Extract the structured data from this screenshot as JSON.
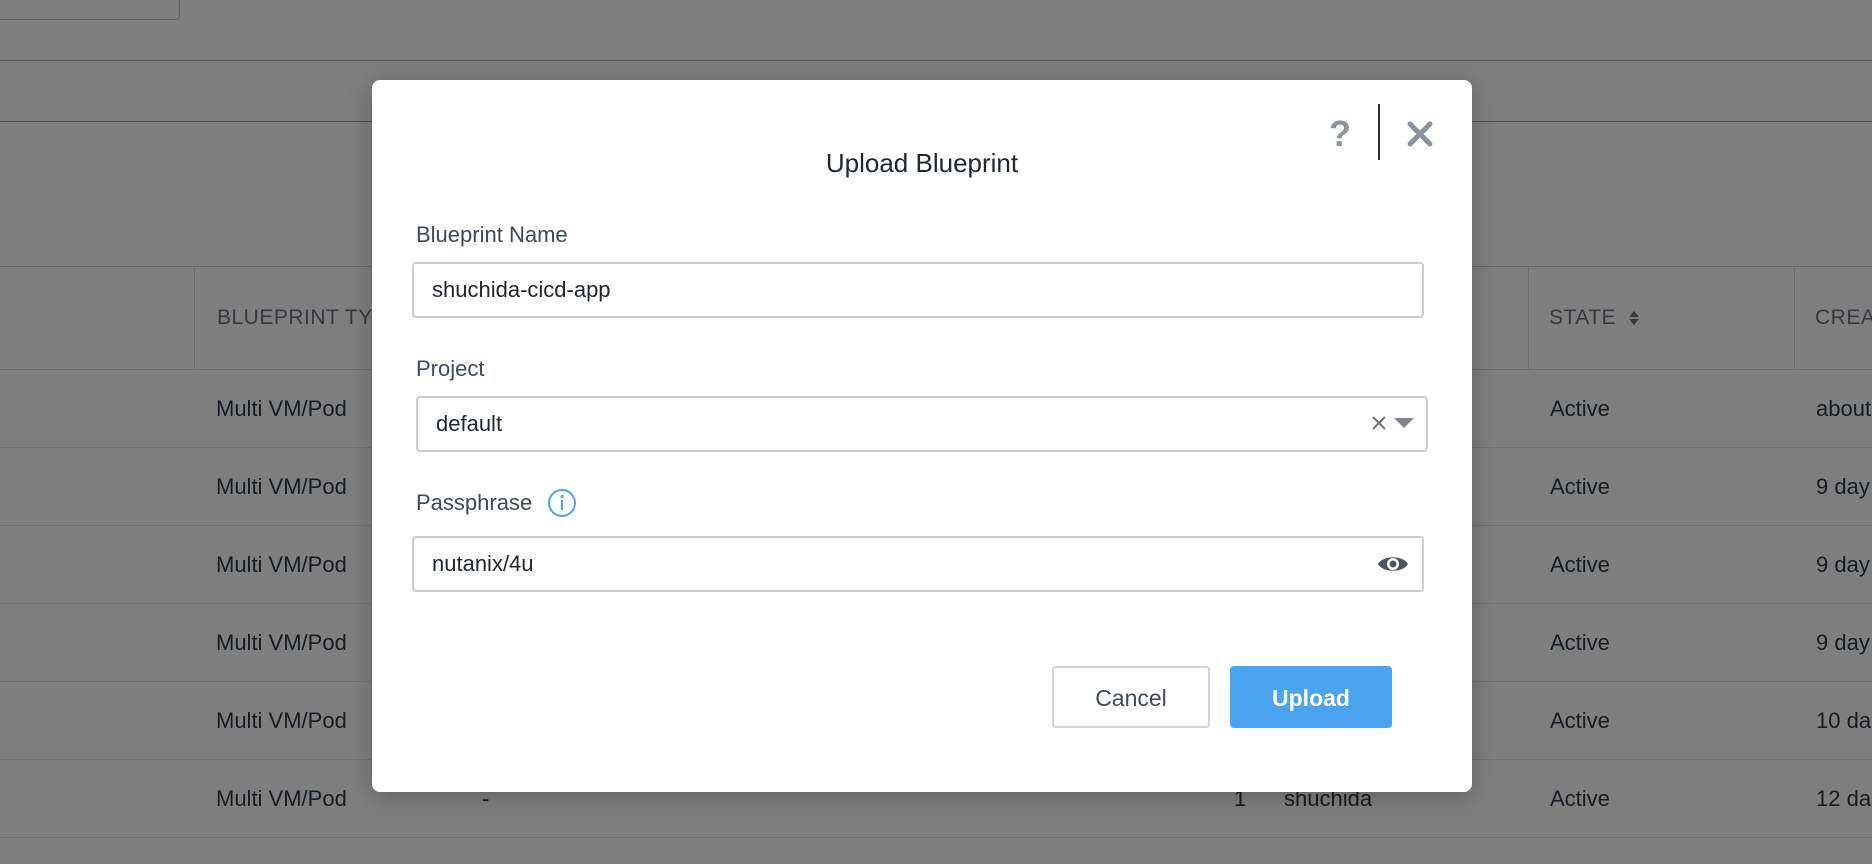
{
  "background": {
    "table": {
      "headers": [
        "BLUEPRINT TY",
        "STATE",
        "CREA"
      ],
      "rows": [
        {
          "type": "Multi VM/Pod",
          "state": "Active",
          "created": "about"
        },
        {
          "type": "Multi VM/Pod",
          "state": "Active",
          "created": "9 day"
        },
        {
          "type": "Multi VM/Pod",
          "state": "Active",
          "created": "9 day"
        },
        {
          "type": "Multi VM/Pod",
          "state": "Active",
          "created": "9 day"
        },
        {
          "type": "Multi VM/Pod",
          "state": "Active",
          "created": "10 da"
        },
        {
          "type": "Multi VM/Pod",
          "dash": "-",
          "count": "1",
          "owner": "shuchida",
          "state": "Active",
          "created": "12 da"
        }
      ]
    }
  },
  "modal": {
    "title": "Upload Blueprint",
    "help_label": "?",
    "fields": {
      "name": {
        "label": "Blueprint Name",
        "value": "shuchida-cicd-app"
      },
      "project": {
        "label": "Project",
        "value": "default"
      },
      "passphrase": {
        "label": "Passphrase",
        "value": "nutanix/4u"
      }
    },
    "buttons": {
      "cancel": "Cancel",
      "upload": "Upload"
    }
  },
  "colors": {
    "primary": "#4aa3ee",
    "overlay": "rgba(0,0,0,0.5)"
  },
  "icons": [
    "help-icon",
    "close-icon",
    "info-icon",
    "clear-icon",
    "chevron-down-icon",
    "eye-icon",
    "sort-icon"
  ]
}
